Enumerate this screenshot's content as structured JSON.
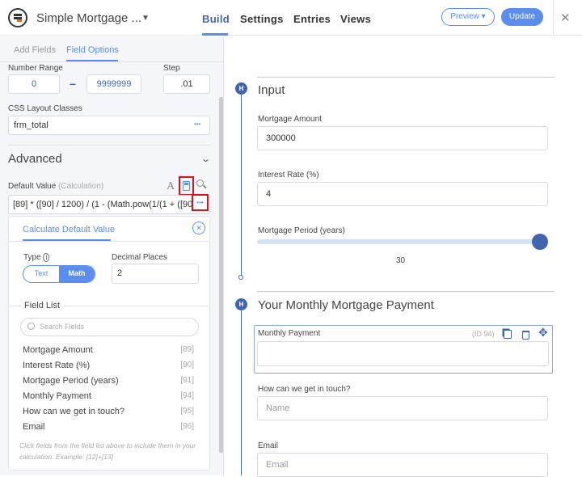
{
  "header": {
    "form_title": "Simple Mortgage ...",
    "nav": [
      "Build",
      "Settings",
      "Entries",
      "Views"
    ],
    "preview": "Preview ▾",
    "update": "Update",
    "close": "✕"
  },
  "sidebar": {
    "tabs": [
      "Add Fields",
      "Field Options"
    ],
    "number_range_label": "Number Range",
    "range_min": "0",
    "range_sep": "–",
    "range_max": "9999999",
    "step_label": "Step",
    "step": ".01",
    "css_label": "CSS Layout Classes",
    "css_value": "frm_total",
    "more": "•••",
    "advanced": "Advanced",
    "default_label": "Default Value",
    "default_sub": "(Calculation)",
    "default_value": "[89] * ([90] / 1200) / (1 - (Math.pow(1/(1 + ([90",
    "calc": {
      "title": "Calculate Default Value",
      "type_label": "Type",
      "type_options": [
        "Text",
        "Math"
      ],
      "decimal_label": "Decimal Places",
      "decimal_value": "2",
      "field_list_label": "Field List",
      "search_placeholder": "Search Fields",
      "fields": [
        {
          "name": "Mortgage Amount",
          "id": "[89]"
        },
        {
          "name": "Interest Rate (%)",
          "id": "[90]"
        },
        {
          "name": "Mortgage Period (years)",
          "id": "[91]"
        },
        {
          "name": "Monthly Payment",
          "id": "[94]"
        },
        {
          "name": "How can we get in touch?",
          "id": "[95]"
        },
        {
          "name": "Email",
          "id": "[96]"
        }
      ],
      "hint": "Click fields from the field list above to include them in your calculation. Example: [12]+[13]"
    }
  },
  "form": {
    "section1": "Input",
    "amount_label": "Mortgage Amount",
    "amount_value": "300000",
    "rate_label": "Interest Rate (%)",
    "rate_value": "4",
    "period_label": "Mortgage Period (years)",
    "period_value": "30",
    "period_fraction": 1.0,
    "section2": "Your Monthly Mortgage Payment",
    "payment_label": "Monthly Payment",
    "payment_id": "(ID 94)",
    "contact_label": "How can we get in touch?",
    "contact_placeholder": "Name",
    "email_label": "Email",
    "email_placeholder": "Email",
    "badge": "H"
  },
  "colors": {
    "accent": "#5b8def",
    "highlight": "#e0101a"
  }
}
